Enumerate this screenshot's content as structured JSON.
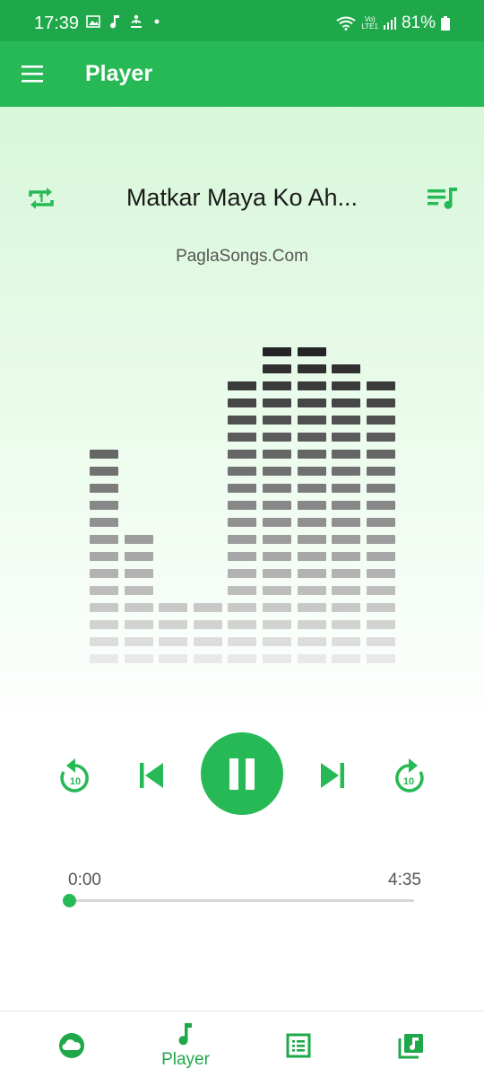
{
  "status_bar": {
    "time": "17:39",
    "icons_left": [
      "image-icon",
      "music-note-icon",
      "meditation-icon",
      "dot-icon"
    ],
    "network_label_top": "Vo)",
    "network_label_bottom": "LTE1",
    "battery": "81%"
  },
  "app_bar": {
    "menu_icon": "hamburger-menu-icon",
    "title": "Player"
  },
  "player": {
    "song_title": "Matkar Maya Ko Ah...",
    "source": "PaglaSongs.Com",
    "repeat_icon": "repeat-one-icon",
    "queue_icon": "queue-music-icon",
    "visualizer_levels": [
      13,
      8,
      4,
      4,
      17,
      19,
      19,
      18,
      17
    ],
    "controls": {
      "rewind_label": "10",
      "forward_label": "10",
      "state": "playing"
    },
    "time_elapsed": "0:00",
    "time_total": "4:35",
    "progress": 0.0
  },
  "bottom_nav": {
    "items": [
      {
        "icon": "cloud-icon",
        "label": ""
      },
      {
        "icon": "music-note-icon",
        "label": "Player"
      },
      {
        "icon": "list-icon",
        "label": ""
      },
      {
        "icon": "library-music-icon",
        "label": ""
      }
    ],
    "active_index": 1
  },
  "colors": {
    "accent": "#27b955",
    "status_bar": "#1fa84a",
    "text_primary": "#1a1a1a",
    "text_secondary": "#555555"
  }
}
